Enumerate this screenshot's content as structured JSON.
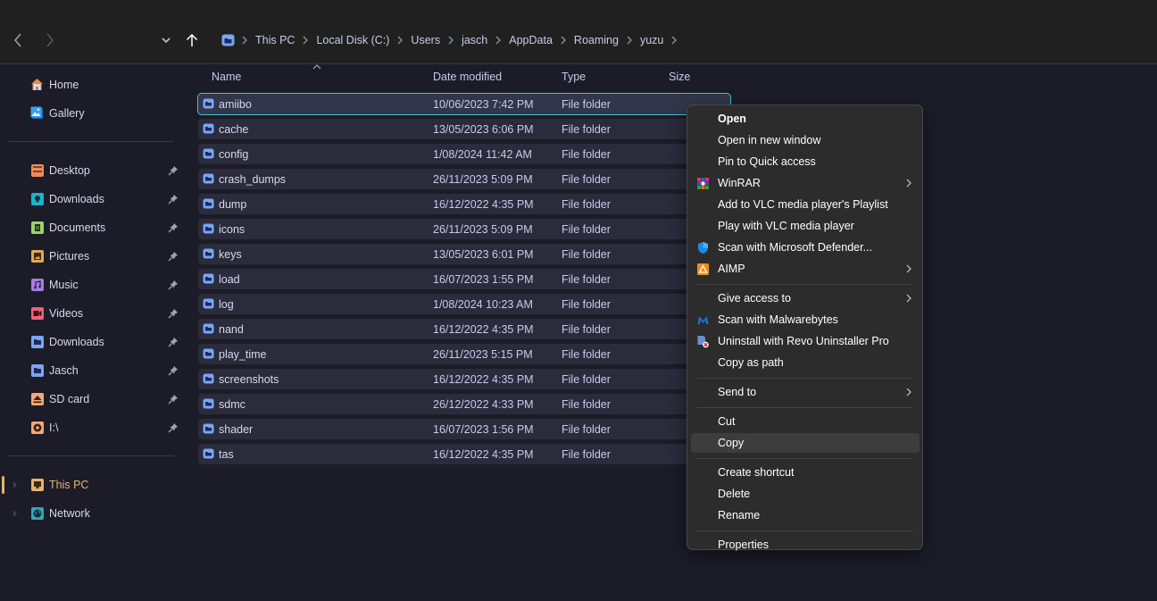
{
  "toolbar": {
    "back_icon": "chevron-left-icon",
    "forward_icon": "chevron-right-icon",
    "recent_icon": "chevron-down-icon",
    "up_icon": "arrow-up-icon",
    "breadcrumb": [
      "This PC",
      "Local Disk (C:)",
      "Users",
      "jasch",
      "AppData",
      "Roaming",
      "yuzu"
    ]
  },
  "sidebar": {
    "top": [
      {
        "label": "Home",
        "icon": "home-icon"
      },
      {
        "label": "Gallery",
        "icon": "gallery-icon"
      }
    ],
    "pinned": [
      {
        "label": "Desktop",
        "icon": "desktop-icon",
        "color": "#f08a5d"
      },
      {
        "label": "Downloads",
        "icon": "downloads-icon",
        "color": "#1fb3c8"
      },
      {
        "label": "Documents",
        "icon": "documents-icon",
        "color": "#9ad36a"
      },
      {
        "label": "Pictures",
        "icon": "pictures-icon",
        "color": "#e2a857"
      },
      {
        "label": "Music",
        "icon": "music-icon",
        "color": "#a77de0"
      },
      {
        "label": "Videos",
        "icon": "videos-icon",
        "color": "#f0627a"
      },
      {
        "label": "Downloads",
        "icon": "folder-icon",
        "color": "#7aa4f5"
      },
      {
        "label": "Jasch",
        "icon": "folder-icon",
        "color": "#7aa4f5"
      },
      {
        "label": "SD card",
        "icon": "eject-icon",
        "color": "#f5a97a"
      },
      {
        "label": "I:\\",
        "icon": "disc-icon",
        "color": "#f5a97a"
      }
    ],
    "bottom": [
      {
        "label": "This PC",
        "icon": "computer-icon",
        "color": "#e4b36f",
        "active": true
      },
      {
        "label": "Network",
        "icon": "network-icon",
        "color": "#3aa3b8",
        "active": false
      }
    ]
  },
  "file_list": {
    "columns": {
      "name": "Name",
      "date": "Date modified",
      "type": "Type",
      "size": "Size"
    },
    "rows": [
      {
        "name": "amiibo",
        "date": "10/06/2023 7:42 PM",
        "type": "File folder",
        "selected": true
      },
      {
        "name": "cache",
        "date": "13/05/2023 6:06 PM",
        "type": "File folder"
      },
      {
        "name": "config",
        "date": "1/08/2024 11:42 AM",
        "type": "File folder"
      },
      {
        "name": "crash_dumps",
        "date": "26/11/2023 5:09 PM",
        "type": "File folder"
      },
      {
        "name": "dump",
        "date": "16/12/2022 4:35 PM",
        "type": "File folder"
      },
      {
        "name": "icons",
        "date": "26/11/2023 5:09 PM",
        "type": "File folder"
      },
      {
        "name": "keys",
        "date": "13/05/2023 6:01 PM",
        "type": "File folder"
      },
      {
        "name": "load",
        "date": "16/07/2023 1:55 PM",
        "type": "File folder"
      },
      {
        "name": "log",
        "date": "1/08/2024 10:23 AM",
        "type": "File folder"
      },
      {
        "name": "nand",
        "date": "16/12/2022 4:35 PM",
        "type": "File folder"
      },
      {
        "name": "play_time",
        "date": "26/11/2023 5:15 PM",
        "type": "File folder"
      },
      {
        "name": "screenshots",
        "date": "16/12/2022 4:35 PM",
        "type": "File folder"
      },
      {
        "name": "sdmc",
        "date": "26/12/2022 4:33 PM",
        "type": "File folder"
      },
      {
        "name": "shader",
        "date": "16/07/2023 1:56 PM",
        "type": "File folder"
      },
      {
        "name": "tas",
        "date": "16/12/2022 4:35 PM",
        "type": "File folder"
      }
    ]
  },
  "context_menu": {
    "groups": [
      [
        {
          "label": "Open",
          "bold": true
        },
        {
          "label": "Open in new window"
        },
        {
          "label": "Pin to Quick access"
        },
        {
          "label": "WinRAR",
          "icon": "winrar-icon",
          "submenu": true
        },
        {
          "label": "Add to VLC media player's Playlist"
        },
        {
          "label": "Play with VLC media player"
        },
        {
          "label": "Scan with Microsoft Defender...",
          "icon": "defender-shield-icon"
        },
        {
          "label": "AIMP",
          "icon": "aimp-icon",
          "submenu": true
        }
      ],
      [
        {
          "label": "Give access to",
          "submenu": true
        },
        {
          "label": "Scan with Malwarebytes",
          "icon": "malwarebytes-icon"
        },
        {
          "label": "Uninstall with Revo Uninstaller Pro",
          "icon": "revo-uninstaller-icon"
        },
        {
          "label": "Copy as path"
        }
      ],
      [
        {
          "label": "Send to",
          "submenu": true
        }
      ],
      [
        {
          "label": "Cut"
        },
        {
          "label": "Copy",
          "hover": true
        }
      ],
      [
        {
          "label": "Create shortcut"
        },
        {
          "label": "Delete"
        },
        {
          "label": "Rename"
        }
      ],
      [
        {
          "label": "Properties"
        }
      ]
    ]
  },
  "colors": {
    "toolbar_bg": "#202020",
    "content_bg": "#1c1c28",
    "row_bg": "#2a2c3c",
    "selection_outline": "#42c4d8",
    "folder_blue": "#7aa4f5",
    "menu_bg": "#2c2c2c",
    "active_accent": "#e4b36f"
  }
}
